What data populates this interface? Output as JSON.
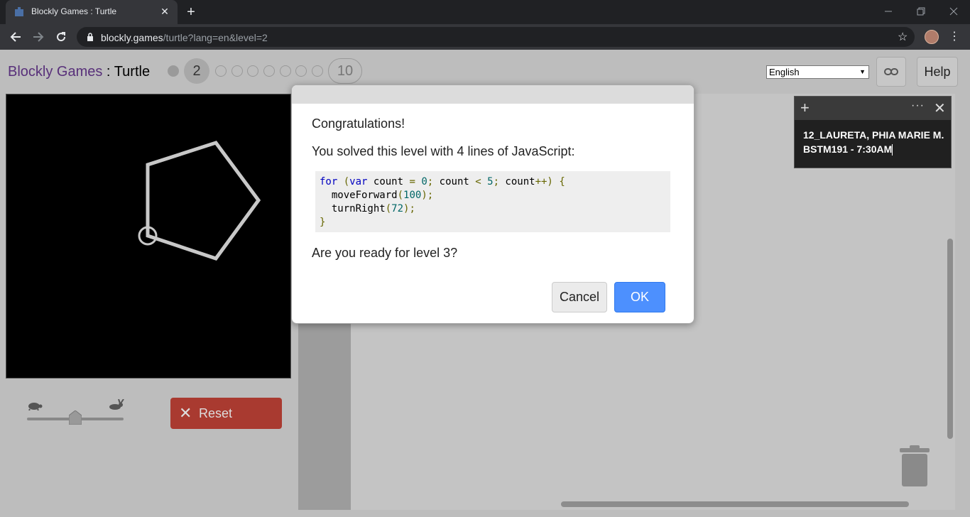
{
  "browser": {
    "tab_title": "Blockly Games : Turtle",
    "new_tab": "+",
    "tab_close": "✕",
    "url_host": "blockly.games",
    "url_path": "/turtle?lang=en&level=2"
  },
  "header": {
    "brand": "Blockly Games",
    "separator": " : ",
    "game": "Turtle",
    "current_level": "2",
    "last_level": "10",
    "solved_levels": [
      1
    ],
    "total_levels": 10
  },
  "language": {
    "selected": "English"
  },
  "buttons": {
    "help": "Help",
    "reset": "Reset"
  },
  "speed": {
    "level": 0.5
  },
  "dialog": {
    "title": "Congratulations!",
    "solved": "You solved this level with 4 lines of JavaScript:",
    "code": [
      "for (var count = 0; count < 5; count++) {",
      "  moveForward(100);",
      "  turnRight(72);",
      "}"
    ],
    "question": "Are you ready for level 3?",
    "cancel": "Cancel",
    "ok": "OK"
  },
  "sticky_note": {
    "line1": "12_LAURETA, PHIA MARIE M.",
    "line2": "BSTM191 - 7:30AM"
  },
  "colors": {
    "brand": "#58307a",
    "ok": "#4d90fe",
    "reset": "#a93a30"
  }
}
